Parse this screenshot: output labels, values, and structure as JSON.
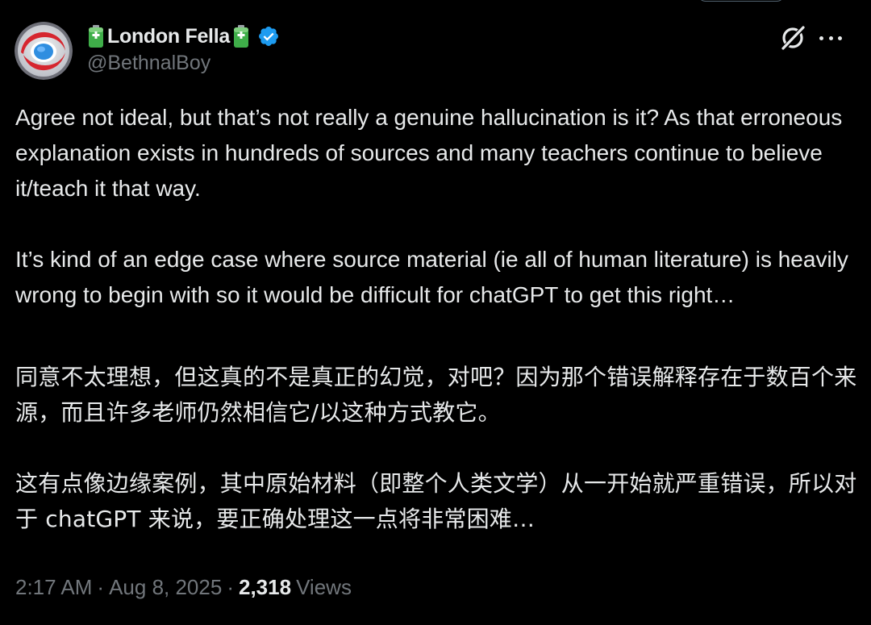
{
  "author": {
    "display_name": "London Fella",
    "handle": "@BethnalBoy",
    "name_emoji": "battery-icon",
    "verified": true,
    "verified_badge_color": "#1d9bf0"
  },
  "header_actions": {
    "grok_icon": "grok-icon",
    "more_icon": "more-icon"
  },
  "tweet": {
    "en_paragraph_1": "Agree not ideal, but that’s not really a genuine hallucination is it?  As that erroneous explanation exists in hundreds of sources and many teachers continue to believe it/teach it that way.",
    "en_paragraph_2": "It’s kind of an edge case where source material (ie all of human literature) is heavily wrong to begin with so it would be difficult for chatGPT to get this right…",
    "zh_paragraph_1": "同意不太理想，但这真的不是真正的幻觉，对吧？因为那个错误解释存在于数百个来源，而且许多老师仍然相信它/以这种方式教它。",
    "zh_paragraph_2": "这有点像边缘案例，其中原始材料（即整个人类文学）从一开始就严重错误，所以对于 chatGPT 来说，要正确处理这一点将非常困难…"
  },
  "meta": {
    "time": "2:17 AM",
    "separator": "·",
    "date": "Aug 8, 2025",
    "views_count": "2,318",
    "views_label": "Views"
  },
  "colors": {
    "background": "#000000",
    "primary_text": "#e7e9ea",
    "secondary_text": "#71767b",
    "accent": "#1d9bf0"
  }
}
